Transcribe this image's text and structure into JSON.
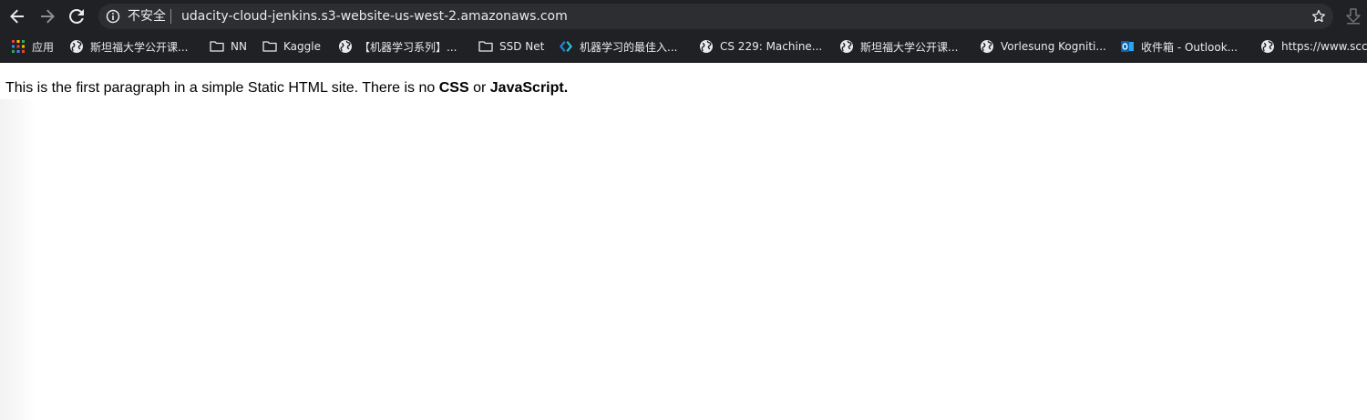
{
  "browser": {
    "security_label": "不安全",
    "url": "udacity-cloud-jenkins.s3-website-us-west-2.amazonaws.com",
    "icons": {
      "back": "arrow-left-icon",
      "forward": "arrow-right-icon",
      "reload": "reload-icon",
      "info": "info-circle-icon",
      "star": "star-icon",
      "download": "download-icon"
    }
  },
  "bookmarks": [
    {
      "label": "应用",
      "icon": "apps-grid-icon"
    },
    {
      "label": "斯坦福大学公开课...",
      "icon": "globe-icon"
    },
    {
      "label": "NN",
      "icon": "folder-icon"
    },
    {
      "label": "Kaggle",
      "icon": "folder-icon"
    },
    {
      "label": "【机器学习系列】...",
      "icon": "globe-icon"
    },
    {
      "label": "SSD Net",
      "icon": "folder-icon"
    },
    {
      "label": "机器学习的最佳入...",
      "icon": "brand-diamond-icon"
    },
    {
      "label": "CS 229: Machine...",
      "icon": "globe-icon"
    },
    {
      "label": "斯坦福大学公开课...",
      "icon": "globe-icon"
    },
    {
      "label": "Vorlesung Kogniti...",
      "icon": "globe-icon"
    },
    {
      "label": "收件箱 - Outlook...",
      "icon": "outlook-icon"
    },
    {
      "label": "https://www.scc",
      "icon": "globe-icon"
    }
  ],
  "page": {
    "text_before": "This is the first paragraph in a simple Static HTML site. There is no ",
    "bold_1": "CSS",
    "text_mid": " or ",
    "bold_2": "JavaScript."
  },
  "colors": {
    "chrome_bg": "#202124",
    "omnibox_bg": "#2d2e31",
    "chrome_text": "#e8eaed",
    "outlook_blue": "#0364b8",
    "diamond_blue": "#1e88e5"
  }
}
